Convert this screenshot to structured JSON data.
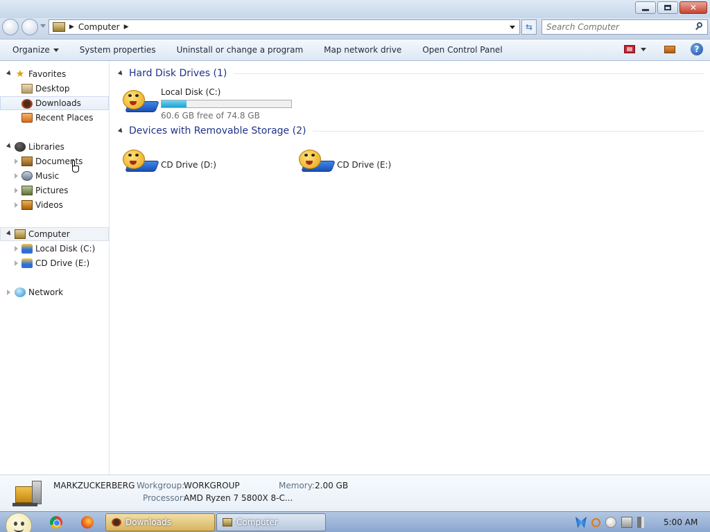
{
  "window": {
    "controls": {
      "minimize": "",
      "maximize": "",
      "close": "✕"
    }
  },
  "address": {
    "crumb": "Computer",
    "search_placeholder": "Search Computer"
  },
  "commandbar": {
    "organize": "Organize",
    "system_properties": "System properties",
    "uninstall": "Uninstall or change a program",
    "map_drive": "Map network drive",
    "control_panel": "Open Control Panel",
    "help": "?"
  },
  "navpane": {
    "favorites": "Favorites",
    "desktop": "Desktop",
    "downloads": "Downloads",
    "recent": "Recent Places",
    "libraries": "Libraries",
    "documents": "Documents",
    "music": "Music",
    "pictures": "Pictures",
    "videos": "Videos",
    "computer": "Computer",
    "local_disk": "Local Disk (C:)",
    "cd_drive": "CD Drive (E:)",
    "network": "Network"
  },
  "content": {
    "hdd_header": "Hard Disk Drives (1)",
    "removable_header": "Devices with Removable Storage (2)",
    "drives": {
      "c": {
        "name": "Local Disk (C:)",
        "free": "60.6 GB free of 74.8 GB",
        "used_fraction": 0.19
      },
      "d": {
        "name": "CD Drive (D:)"
      },
      "e": {
        "name": "CD Drive (E:)"
      }
    }
  },
  "details": {
    "computer_name": "MARKZUCKERBERG",
    "workgroup_label": "Workgroup:",
    "workgroup_value": "WORKGROUP",
    "memory_label": "Memory:",
    "memory_value": "2.00 GB",
    "processor_label": "Processor:",
    "processor_value": "AMD Ryzen 7 5800X 8-C..."
  },
  "taskbar": {
    "task_downloads": "Downloads",
    "task_computer": "Computer",
    "time": "5:00 AM"
  }
}
